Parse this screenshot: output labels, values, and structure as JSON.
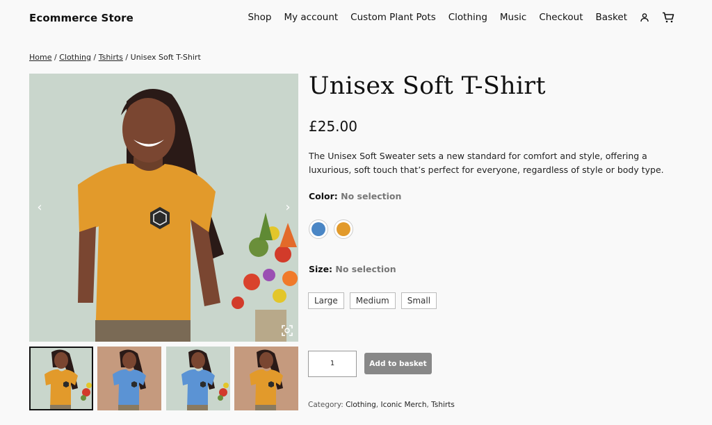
{
  "header": {
    "site_title": "Ecommerce Store",
    "nav": [
      "Shop",
      "My account",
      "Custom Plant Pots",
      "Clothing",
      "Music",
      "Checkout",
      "Basket"
    ],
    "icons": [
      "user-icon",
      "cart-icon"
    ]
  },
  "breadcrumb": {
    "items": [
      "Home",
      "Clothing",
      "Tshirts"
    ],
    "current": "Unisex Soft T-Shirt",
    "separator": "/"
  },
  "gallery": {
    "prev_icon": "‹",
    "next_icon": "›",
    "thumbnails": [
      {
        "shirt_color": "#e29a2b",
        "background": "#c9d6cc"
      },
      {
        "shirt_color": "#5b93d4",
        "background": "#c59a7e"
      },
      {
        "shirt_color": "#5b93d4",
        "background": "#c9d6cc"
      },
      {
        "shirt_color": "#e29a2b",
        "background": "#c59a7e"
      }
    ]
  },
  "product": {
    "title": "Unisex Soft T-Shirt",
    "price": "£25.00",
    "description": "The Unisex Soft Sweater sets a new standard for comfort and style, offering a luxurious, soft touch that’s perfect for everyone, regardless of style or body type.",
    "color_label": "Color:",
    "color_value": "No selection",
    "colors": [
      "#4a86c5",
      "#e29a2b"
    ],
    "size_label": "Size:",
    "size_value": "No selection",
    "sizes": [
      "Large",
      "Medium",
      "Small"
    ],
    "quantity": "1",
    "add_to_basket": "Add to basket",
    "category_label": "Category:",
    "categories": [
      "Clothing",
      "Iconic Merch",
      "Tshirts"
    ]
  }
}
